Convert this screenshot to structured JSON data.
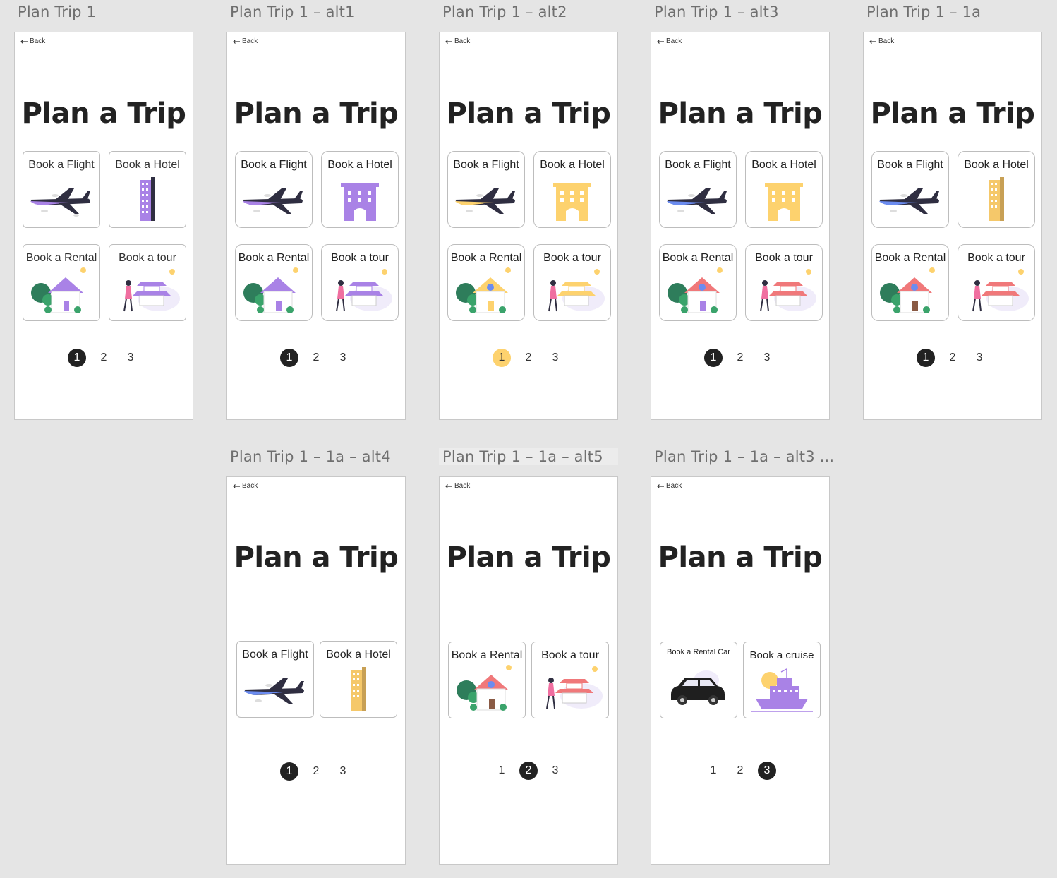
{
  "artboards": [
    {
      "label": "Plan Trip 1",
      "back": "Back",
      "title": "Plan a Trip",
      "cards": [
        "Book a Flight",
        "Book a Hotel",
        "Book a Rental",
        "Book a tour"
      ],
      "pages": [
        "1",
        "2",
        "3"
      ]
    },
    {
      "label": "Plan Trip 1 – alt1",
      "back": "Back",
      "title": "Plan a Trip",
      "cards": [
        "Book a Flight",
        "Book a Hotel",
        "Book a Rental",
        "Book a tour"
      ],
      "pages": [
        "1",
        "2",
        "3"
      ]
    },
    {
      "label": "Plan Trip 1 – alt2",
      "back": "Back",
      "title": "Plan a Trip",
      "cards": [
        "Book a Flight",
        "Book a Hotel",
        "Book a Rental",
        "Book a tour"
      ],
      "pages": [
        "1",
        "2",
        "3"
      ]
    },
    {
      "label": "Plan Trip 1 – alt3",
      "back": "Back",
      "title": "Plan a Trip",
      "cards": [
        "Book a Flight",
        "Book a Hotel",
        "Book a Rental",
        "Book a tour"
      ],
      "pages": [
        "1",
        "2",
        "3"
      ]
    },
    {
      "label": "Plan Trip 1 – 1a",
      "back": "Back",
      "title": "Plan a Trip",
      "cards": [
        "Book a Flight",
        "Book a Hotel",
        "Book a Rental",
        "Book a tour"
      ],
      "pages": [
        "1",
        "2",
        "3"
      ]
    },
    {
      "label": "Plan Trip 1 – 1a – alt4",
      "back": "Back",
      "title": "Plan a Trip",
      "cards": [
        "Book a Flight",
        "Book a Hotel"
      ],
      "pages": [
        "1",
        "2",
        "3"
      ]
    },
    {
      "label": "Plan Trip 1 – 1a – alt5",
      "back": "Back",
      "title": "Plan a Trip",
      "cards": [
        "Book a Rental",
        "Book a tour"
      ],
      "pages": [
        "1",
        "2",
        "3"
      ]
    },
    {
      "label": "Plan Trip 1 – 1a – alt3 ...",
      "back": "Back",
      "title": "Plan a Trip",
      "cards": [
        "Book a Rental Car",
        "Book a cruise"
      ],
      "pages": [
        "1",
        "2",
        "3"
      ]
    }
  ],
  "colors": {
    "background": "#e5e5e5",
    "purple": "#a982e6",
    "yellow": "#fdd26e",
    "coral": "#f0787a",
    "blue": "#6b8cf0",
    "dark": "#2f2e41",
    "active_dot": "#222222"
  },
  "icons": [
    "back-arrow-icon",
    "airplane-icon",
    "hotel-building-icon",
    "house-icon",
    "pagoda-tour-icon",
    "car-icon",
    "cruise-ship-icon"
  ]
}
